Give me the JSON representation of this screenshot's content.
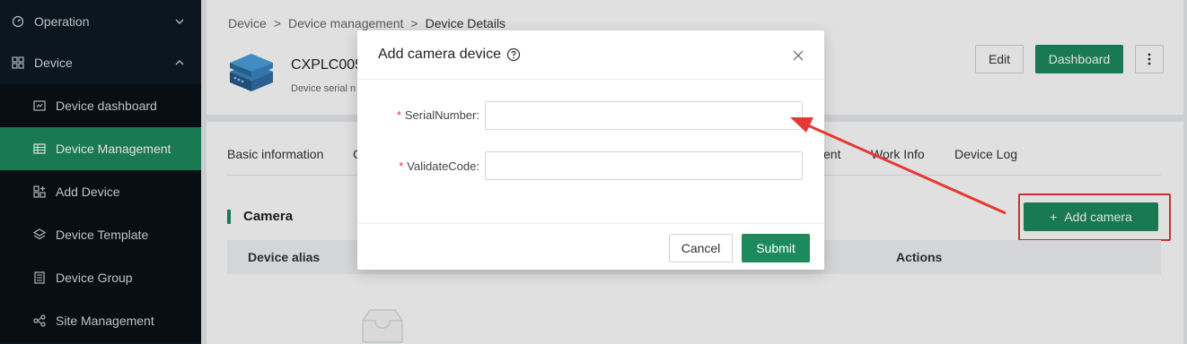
{
  "sidebar": {
    "items": [
      {
        "label": "Operation",
        "icon": "gauge-icon"
      },
      {
        "label": "Device",
        "icon": "grid-icon"
      },
      {
        "label": "Device dashboard",
        "icon": "dashboard-icon"
      },
      {
        "label": "Device Management",
        "icon": "table-icon"
      },
      {
        "label": "Add Device",
        "icon": "add-device-icon"
      },
      {
        "label": "Device Template",
        "icon": "template-icon"
      },
      {
        "label": "Device Group",
        "icon": "group-icon"
      },
      {
        "label": "Site Management",
        "icon": "site-icon"
      }
    ],
    "active_index": 3,
    "accent_color": "#1d8a5e",
    "bg_color": "#0d1a24"
  },
  "breadcrumb": {
    "items": [
      "Device",
      "Device management",
      "Device Details"
    ],
    "separator": ">"
  },
  "device": {
    "name": "CXPLC005C",
    "serial_label": "Device serial n"
  },
  "header_actions": {
    "edit": "Edit",
    "dashboard": "Dashboard"
  },
  "tabs": [
    "Basic information",
    "C",
    "ent",
    "Work Info",
    "Device Log"
  ],
  "camera_section": {
    "title": "Camera",
    "add_button": "Add camera",
    "columns": [
      "Device alias",
      "Actions"
    ]
  },
  "modal": {
    "title": "Add camera device",
    "fields": [
      {
        "label": "SerialNumber",
        "required": true,
        "value": "",
        "placeholder": ""
      },
      {
        "label": "ValidateCode",
        "required": true,
        "value": "",
        "placeholder": ""
      }
    ],
    "cancel": "Cancel",
    "submit": "Submit"
  }
}
